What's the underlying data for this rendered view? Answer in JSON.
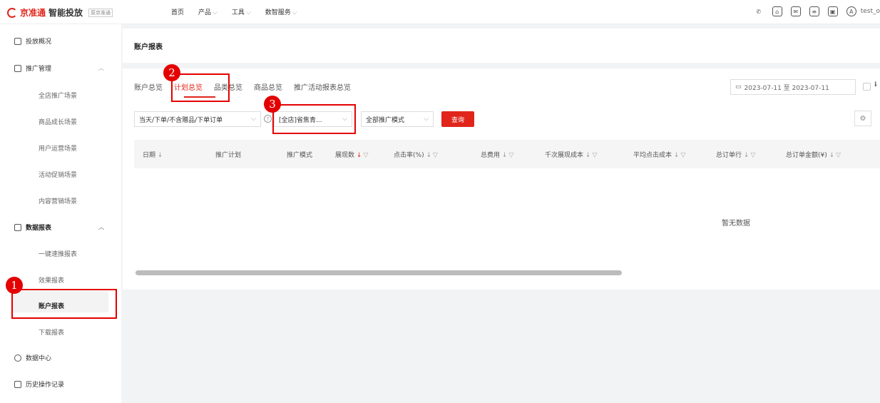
{
  "header": {
    "brand_name": "京准通",
    "brand_product": "智能投放",
    "brand_badge": "原京准通",
    "nav": [
      {
        "label": "首页",
        "chevron": ""
      },
      {
        "label": "产品",
        "chevron": "⌵"
      },
      {
        "label": "工具",
        "chevron": "⌵"
      },
      {
        "label": "数智服务",
        "chevron": "⌵"
      }
    ],
    "user": "test_o"
  },
  "sidebar": {
    "overview": "投放概况",
    "promo_mgmt": "推广管理",
    "promo_items": [
      "全店推广场景",
      "商品成长场景",
      "用户运营场景",
      "活动促销场景",
      "内容营销场景"
    ],
    "data_reports": "数据报表",
    "report_items": [
      "一键速推报表",
      "效果报表",
      "账户报表",
      "下载报表"
    ],
    "data_center": "数据中心",
    "history": "历史操作记录"
  },
  "main": {
    "page_title": "账户报表",
    "tabs": [
      "账户总览",
      "计划总览",
      "品类总览",
      "商品总览",
      "推广活动报表总览"
    ],
    "active_tab": "计划总览",
    "date_range": "2023-07-11 至 2023-07-11",
    "filters": {
      "time_scope": "当天/下单/不含赠品/下单订单",
      "campaign_scope": "[全店]省焦青...",
      "promo_mode": "全部推广模式",
      "query_button": "查询"
    },
    "columns": [
      {
        "label": "日期",
        "sort": "↓",
        "filter": ""
      },
      {
        "label": "推广计划",
        "sort": "",
        "filter": ""
      },
      {
        "label": "推广模式",
        "sort": "",
        "filter": ""
      },
      {
        "label": "展现数",
        "sort": "↓",
        "filter": "▽"
      },
      {
        "label": "点击率(%)",
        "sort": "↓",
        "filter": "▽"
      },
      {
        "label": "总费用",
        "sort": "↓",
        "filter": "▽"
      },
      {
        "label": "千次展现成本",
        "sort": "↓",
        "filter": "▽"
      },
      {
        "label": "平均点击成本",
        "sort": "↓",
        "filter": "▽"
      },
      {
        "label": "总订单行",
        "sort": "↓",
        "filter": "▽"
      },
      {
        "label": "总订单金额(¥)",
        "sort": "↓",
        "filter": "▽"
      }
    ],
    "empty_text": "暂无数据"
  },
  "annotations": {
    "marker_1": "1",
    "marker_2": "2",
    "marker_3": "3"
  },
  "colors": {
    "accent": "#e1251b",
    "annotation": "#e40000"
  }
}
